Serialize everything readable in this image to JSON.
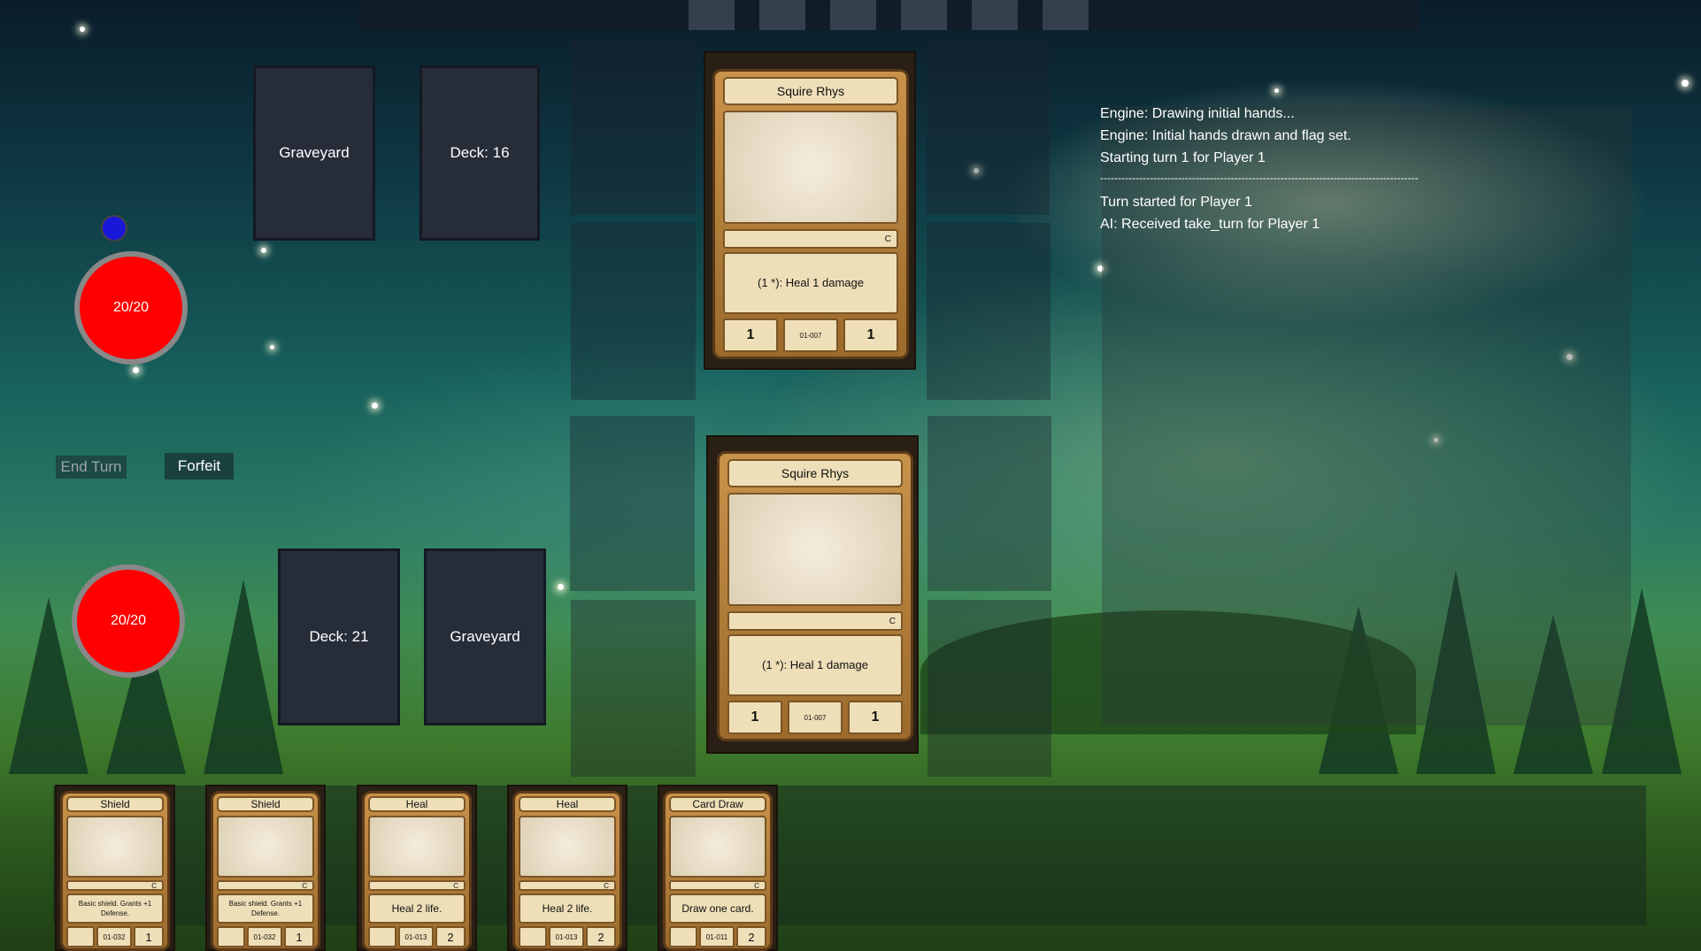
{
  "top_bar": {
    "slots": 6
  },
  "opponent": {
    "graveyard_label": "Graveyard",
    "deck_label": "Deck: 16",
    "life": "20/20"
  },
  "player": {
    "graveyard_label": "Graveyard",
    "deck_label": "Deck: 21",
    "life": "20/20"
  },
  "buttons": {
    "end_turn": "End Turn",
    "forfeit": "Forfeit"
  },
  "board": {
    "opponent_card": {
      "name": "Squire Rhys",
      "rarity": "C",
      "text": "(1 *): Heal 1 damage",
      "attack": "1",
      "id": "01-007",
      "defense": "1"
    },
    "player_card": {
      "name": "Squire Rhys",
      "rarity": "C",
      "text": "(1 *): Heal 1 damage",
      "attack": "1",
      "id": "01-007",
      "defense": "1"
    }
  },
  "log": [
    "Engine: Drawing initial hands...",
    "Engine: Initial hands drawn and flag set.",
    "Starting turn 1 for Player 1",
    "------------------------------------------------------------------------------------------",
    "Turn started for Player 1",
    "AI: Received take_turn for Player 1"
  ],
  "hand": [
    {
      "name": "Shield",
      "rarity": "C",
      "text": "Basic shield. Grants +1 Defense.",
      "id": "01-032",
      "cost": "1"
    },
    {
      "name": "Shield",
      "rarity": "C",
      "text": "Basic shield. Grants +1 Defense.",
      "id": "01-032",
      "cost": "1"
    },
    {
      "name": "Heal",
      "rarity": "C",
      "text": "Heal 2 life.",
      "id": "01-013",
      "cost": "2"
    },
    {
      "name": "Heal",
      "rarity": "C",
      "text": "Heal 2 life.",
      "id": "01-013",
      "cost": "2"
    },
    {
      "name": "Card Draw",
      "rarity": "C",
      "text": "Draw one card.",
      "id": "01-011",
      "cost": "2"
    }
  ],
  "colors": {
    "life_orb": "#ff0000",
    "turn_indicator": "#1818d8",
    "pile_bg": "#262d39"
  }
}
